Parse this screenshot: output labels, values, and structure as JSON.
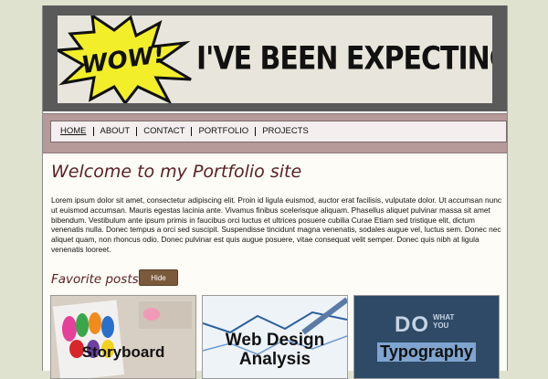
{
  "banner": {
    "burst_text": "WOW!",
    "headline": "I'VE BEEN EXPECTING YOU"
  },
  "nav": {
    "items": [
      {
        "label": "HOME"
      },
      {
        "label": "ABOUT"
      },
      {
        "label": "CONTACT"
      },
      {
        "label": "PORTFOLIO"
      },
      {
        "label": "PROJECTS"
      }
    ]
  },
  "main": {
    "heading": "Welcome to my Portfolio site",
    "paragraph": "Lorem ipsum dolor sit amet, consectetur adipiscing elit. Proin id ligula euismod, auctor erat facilisis, vulputate dolor. Ut accumsan nunc ut euismod accumsan. Mauris egestas lacinia ante. Vivamus finibus scelerisque aliquam. Phasellus aliquet pulvinar massa sit amet bibendum. Vestibulum ante ipsum primis in faucibus orci luctus et ultrices posuere cubilia Curae Etiam sed tristique elit, dictum venenatis nulla. Donec tempus a orci sed suscipit. Suspendisse tincidunt magna venenatis, sodales augue vel, luctus sem. Donec nec aliquet quam, non rhoncus odio. Donec pulvinar est quis augue posuere, vitae consequat velit semper. Donec quis nibh at ligula venenatis looreet."
  },
  "favorites": {
    "heading": "Favorite posts",
    "hide_label": "Hide",
    "cards": [
      {
        "label": "Storyboard"
      },
      {
        "label": "Web Design Analysis"
      },
      {
        "label": "Typography",
        "image_text_big": "DO",
        "image_text_small_1": "WHAT",
        "image_text_small_2": "YOU"
      }
    ]
  },
  "colors": {
    "background": "#dfe2cf",
    "accent": "#5a1f24",
    "nav_bg": "#b59a9a",
    "button": "#7a5a3a"
  }
}
